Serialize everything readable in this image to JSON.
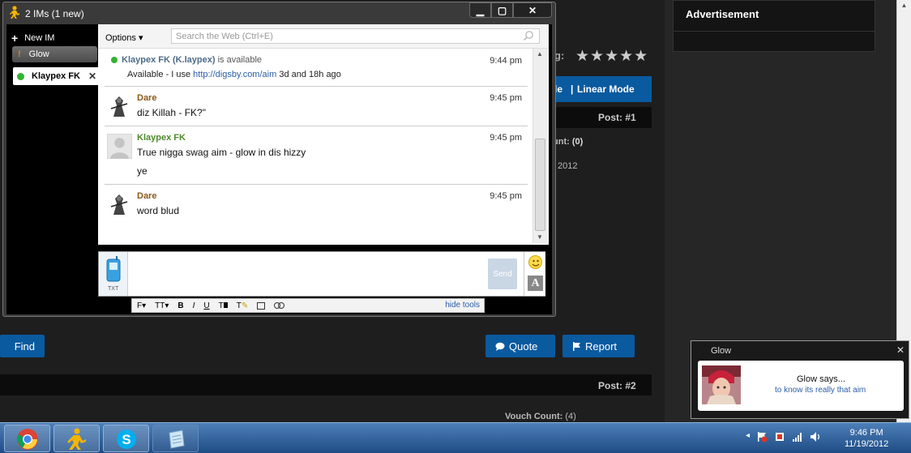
{
  "background": {
    "advertisement_title": "Advertisement",
    "rating_label": "g:",
    "stars": "★★★★★",
    "mode_fragment": "de",
    "mode_separator": "|",
    "linear_mode": "Linear Mode",
    "post1": "Post: #1",
    "count_fragment": "unt:",
    "count_value": "(0)",
    "year_fragment": "2012",
    "find_button": "Find",
    "quote_button": "Quote",
    "report_button": "Report",
    "post2": "Post: #2",
    "vouch_count_label": "Vouch Count:",
    "vouch_count_value": "(4)"
  },
  "im_window": {
    "title": "2 IMs (1 new)",
    "controls": {
      "minimize": "▁",
      "maximize": "▢",
      "close": "✕"
    },
    "sidebar": {
      "new_im": "New IM",
      "tabs": [
        {
          "label": "Glow",
          "status": "new-message"
        },
        {
          "label": "Klaypex FK",
          "status": "available",
          "close": "✕"
        }
      ]
    },
    "toolbar": {
      "options_label": "Options",
      "search_placeholder": "Search the Web      (Ctrl+E)"
    },
    "status": {
      "name": "Klaypex FK (K.laypex)",
      "state": "is available",
      "time": "9:44 pm",
      "message_prefix": "Available - I use",
      "link": "http://digsby.com/aim",
      "message_suffix": "3d and 18h ago"
    },
    "messages": [
      {
        "sender": "Dare",
        "time": "9:45 pm",
        "lines": [
          "diz Killah - FK?\""
        ]
      },
      {
        "sender": "Klaypex FK",
        "time": "9:45 pm",
        "lines": [
          "True nigga swag aim - glow in dis hizzy",
          "ye"
        ]
      },
      {
        "sender": "Dare",
        "time": "9:45 pm",
        "lines": [
          "word blud"
        ]
      }
    ],
    "input": {
      "txt_label": "TXT",
      "send_label": "Send",
      "value": ""
    },
    "format_tools": {
      "font": "F▾",
      "size": "TT▾",
      "bold": "B",
      "italic": "I",
      "underline": "U",
      "text_color": "T",
      "highlight": "T",
      "hide_tools": "hide tools"
    }
  },
  "notification": {
    "title": "Glow",
    "close": "✕",
    "who": "Glow says...",
    "message": "to know its really that aim"
  },
  "taskbar": {
    "apps": [
      "chrome-icon",
      "aim-icon",
      "skype-icon",
      "notepad-icon"
    ],
    "tray_arrow": "◂",
    "time": "9:46 PM",
    "date": "11/19/2012"
  },
  "colors": {
    "accent_blue": "#0a5aa0",
    "available_green": "#34b233",
    "dare_name": "#8a5a1b",
    "klaypex_name": "#4d8a2a",
    "link": "#2b5ea8"
  }
}
